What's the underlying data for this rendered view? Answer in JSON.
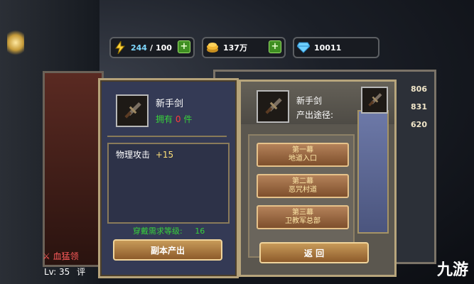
{
  "currency": {
    "energy": {
      "icon": "lightning-icon",
      "current": "244",
      "separator": "/",
      "max": "100"
    },
    "gold": {
      "icon": "gold-coin-icon",
      "value": "137万"
    },
    "gems": {
      "icon": "diamond-icon",
      "value": "10011"
    }
  },
  "left_card": {
    "item_name": "新手剑",
    "owned_prefix": "拥有",
    "owned_count": "0",
    "owned_suffix": "件",
    "attr_name": "物理攻击",
    "attr_value": "+15",
    "req_label": "穿戴需求等级:",
    "req_value": "16",
    "button": "副本产出"
  },
  "right_card": {
    "item_name": "新手剑",
    "source_label": "产出途径:",
    "stages": [
      {
        "line1": "第一幕",
        "line2": "地道入口"
      },
      {
        "line1": "第二幕",
        "line2": "恶咒村道"
      },
      {
        "line1": "第三幕",
        "line2": "卫教军总部"
      }
    ],
    "back_button": "返 回"
  },
  "side_stats": [
    "806",
    "831",
    "620"
  ],
  "player": {
    "guild": "血猛领",
    "level_label": "Lv:",
    "level": "35",
    "rating": "评"
  },
  "watermark": "九游",
  "colors": {
    "owned_count": "#ff3b3b",
    "green": "#38d23b",
    "accent_gold": "#b5a27a"
  }
}
